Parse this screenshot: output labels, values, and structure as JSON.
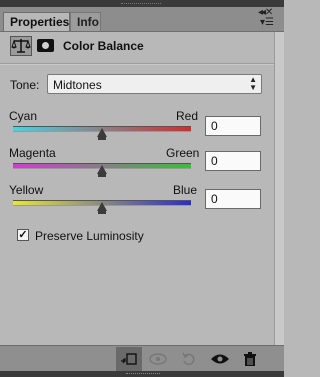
{
  "tabs": [
    {
      "label": "Properties",
      "active": true
    },
    {
      "label": "Info",
      "active": false
    }
  ],
  "panel": {
    "title": "Color Balance",
    "icons": [
      "balance-scale-icon",
      "layer-mask-icon"
    ]
  },
  "tone": {
    "label": "Tone:",
    "selected": "Midtones"
  },
  "sliders": [
    {
      "left_label": "Cyan",
      "right_label": "Red",
      "value": "0",
      "position": 0.5
    },
    {
      "left_label": "Magenta",
      "right_label": "Green",
      "value": "0",
      "position": 0.5
    },
    {
      "left_label": "Yellow",
      "right_label": "Blue",
      "value": "0",
      "position": 0.5
    }
  ],
  "preserve": {
    "label": "Preserve Luminosity",
    "checked": true
  },
  "bottom_toolbar": [
    "clip-to-layer-icon",
    "view-previous-state-icon",
    "reset-icon",
    "toggle-visibility-icon",
    "delete-icon"
  ],
  "colors": {
    "panel_bg": "#b8b8b8",
    "cyan": "#3fd7e6",
    "red": "#d82a2a",
    "magenta": "#d23ad2",
    "green": "#38c038",
    "yellow": "#e8e82a",
    "blue": "#2a2ad8"
  }
}
